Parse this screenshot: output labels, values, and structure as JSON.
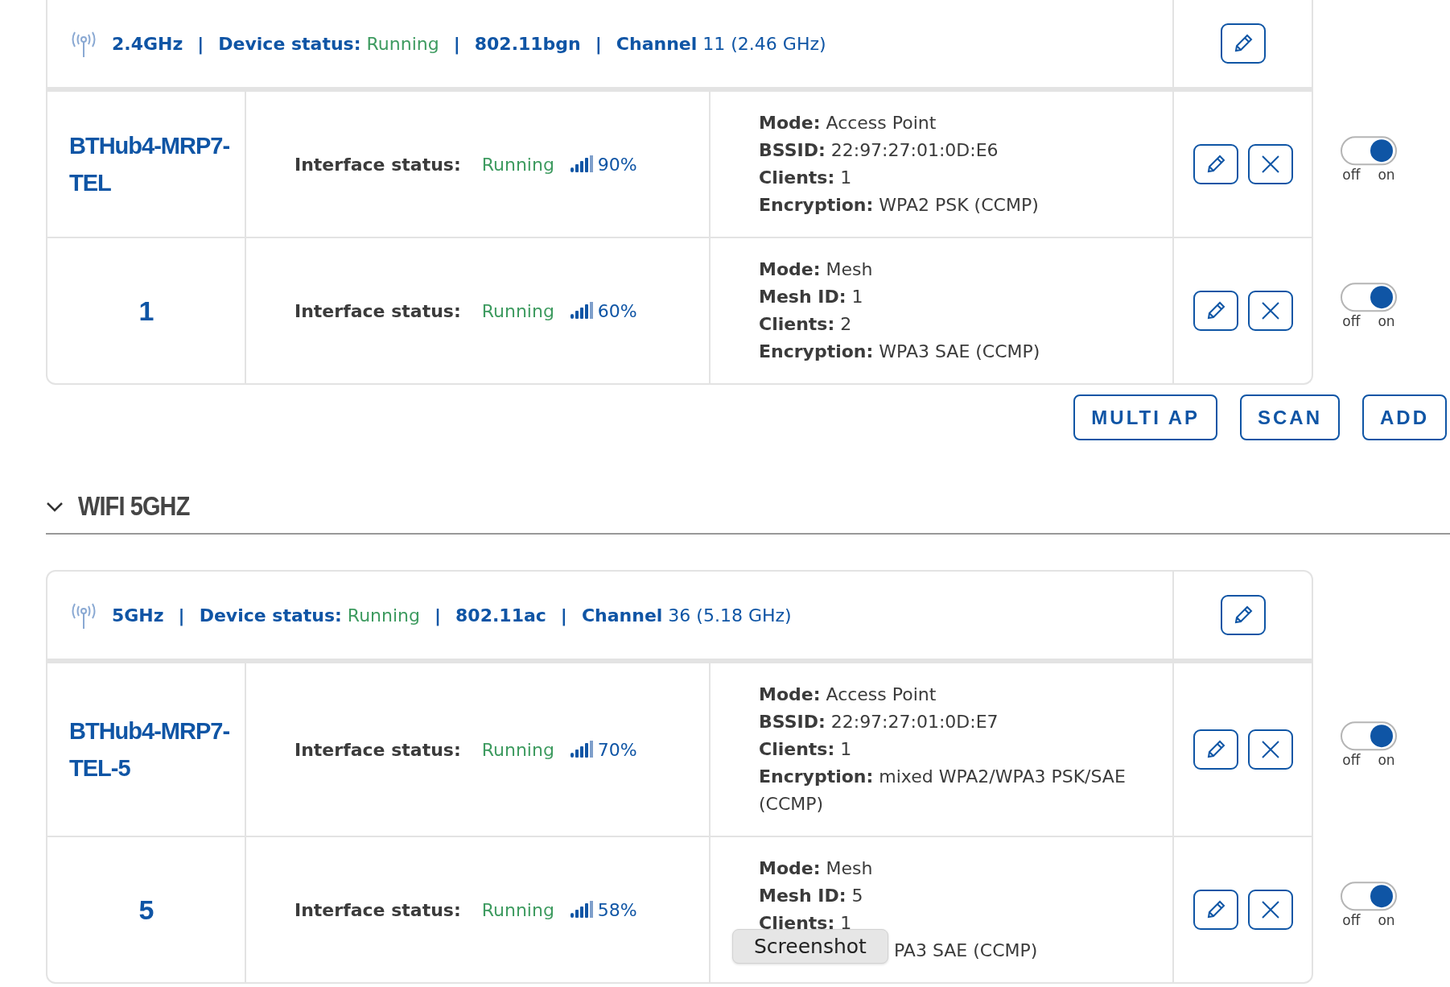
{
  "radio_24": {
    "header": {
      "band": "2.4GHz",
      "separator": "|",
      "status": {
        "label": "Device status:",
        "value": "Running"
      },
      "standard": "802.11bgn",
      "channel": {
        "label": "Channel",
        "value": "11 (2.46 GHz)"
      }
    },
    "interfaces": [
      {
        "kind": "ap",
        "name": "BTHub4-MRP7-TEL",
        "status_label": "Interface status:",
        "status": "Running",
        "signal": "90%",
        "info": [
          {
            "kind": "field",
            "label": "Mode:",
            "value": "Access Point"
          },
          {
            "kind": "field",
            "label": "BSSID:",
            "value": "22:97:27:01:0D:E6"
          },
          {
            "kind": "field",
            "label": "Clients:",
            "value": "1"
          },
          {
            "kind": "field",
            "label": "Encryption:",
            "value": "WPA2 PSK (CCMP)"
          }
        ],
        "toggle": {
          "on": true,
          "off_label": "off",
          "on_label": "on"
        }
      },
      {
        "kind": "mesh",
        "name": "1",
        "status_label": "Interface status:",
        "status": "Running",
        "signal": "60%",
        "info": [
          {
            "kind": "field",
            "label": "Mode:",
            "value": "Mesh"
          },
          {
            "kind": "field",
            "label": "Mesh ID:",
            "value": "1"
          },
          {
            "kind": "field",
            "label": "Clients:",
            "value": "2"
          },
          {
            "kind": "field",
            "label": "Encryption:",
            "value": "WPA3 SAE (CCMP)"
          }
        ],
        "toggle": {
          "on": true,
          "off_label": "off",
          "on_label": "on"
        }
      }
    ]
  },
  "actions": [
    "MULTI AP",
    "SCAN",
    "ADD"
  ],
  "section": {
    "title": "WIFI 5GHZ",
    "expanded": true,
    "radio": {
      "header": {
        "band": "5GHz",
        "separator": "|",
        "status": {
          "label": "Device status:",
          "value": "Running"
        },
        "standard": "802.11ac",
        "channel": {
          "label": "Channel",
          "value": "36 (5.18 GHz)"
        }
      },
      "interfaces": [
        {
          "kind": "ap",
          "name": "BTHub4-MRP7-TEL-5",
          "status_label": "Interface status:",
          "status": "Running",
          "signal": "70%",
          "info": [
            {
              "kind": "field",
              "label": "Mode:",
              "value": "Access Point"
            },
            {
              "kind": "field",
              "label": "BSSID:",
              "value": "22:97:27:01:0D:E7"
            },
            {
              "kind": "field",
              "label": "Clients:",
              "value": "1"
            },
            {
              "kind": "field",
              "label": "Encryption:",
              "value": "mixed WPA2/WPA3 PSK/SAE (CCMP)"
            }
          ],
          "toggle": {
            "on": true,
            "off_label": "off",
            "on_label": "on"
          }
        },
        {
          "kind": "mesh",
          "name": "5",
          "status_label": "Interface status:",
          "status": "Running",
          "signal": "58%",
          "info": [
            {
              "kind": "field",
              "label": "Mode:",
              "value": "Mesh"
            },
            {
              "kind": "field",
              "label": "Mesh ID:",
              "value": "5"
            },
            {
              "kind": "field",
              "label": "Clients:",
              "value": "1"
            },
            {
              "kind": "covered",
              "value": "PA3 SAE (CCMP)"
            }
          ],
          "toggle": {
            "on": true,
            "off_label": "off",
            "on_label": "on"
          }
        }
      ]
    }
  },
  "tooltip": {
    "text": "Screenshot"
  }
}
